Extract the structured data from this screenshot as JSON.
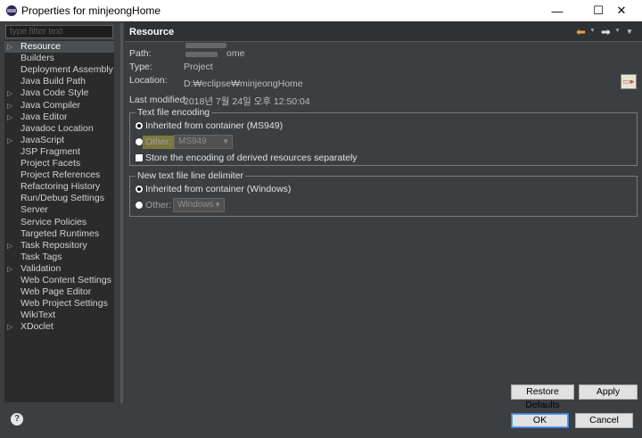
{
  "window": {
    "title": "Properties for minjeongHome",
    "minimize_glyph": "—",
    "maximize_glyph": "☐",
    "close_glyph": "✕"
  },
  "sidebar": {
    "filter_placeholder": "type filter text",
    "items": [
      {
        "label": "Resource",
        "has_arrow": true,
        "selected": true
      },
      {
        "label": "Builders",
        "has_arrow": false
      },
      {
        "label": "Deployment Assembly",
        "has_arrow": false
      },
      {
        "label": "Java Build Path",
        "has_arrow": false
      },
      {
        "label": "Java Code Style",
        "has_arrow": true
      },
      {
        "label": "Java Compiler",
        "has_arrow": true
      },
      {
        "label": "Java Editor",
        "has_arrow": true
      },
      {
        "label": "Javadoc Location",
        "has_arrow": false
      },
      {
        "label": "JavaScript",
        "has_arrow": true
      },
      {
        "label": "JSP Fragment",
        "has_arrow": false
      },
      {
        "label": "Project Facets",
        "has_arrow": false
      },
      {
        "label": "Project References",
        "has_arrow": false
      },
      {
        "label": "Refactoring History",
        "has_arrow": false
      },
      {
        "label": "Run/Debug Settings",
        "has_arrow": false
      },
      {
        "label": "Server",
        "has_arrow": false
      },
      {
        "label": "Service Policies",
        "has_arrow": false
      },
      {
        "label": "Targeted Runtimes",
        "has_arrow": false
      },
      {
        "label": "Task Repository",
        "has_arrow": true
      },
      {
        "label": "Task Tags",
        "has_arrow": false
      },
      {
        "label": "Validation",
        "has_arrow": true
      },
      {
        "label": "Web Content Settings",
        "has_arrow": false
      },
      {
        "label": "Web Page Editor",
        "has_arrow": false
      },
      {
        "label": "Web Project Settings",
        "has_arrow": false
      },
      {
        "label": "WikiText",
        "has_arrow": false
      },
      {
        "label": "XDoclet",
        "has_arrow": true
      }
    ]
  },
  "panel": {
    "title": "Resource",
    "path_label": "Path:",
    "path_value": "ome",
    "type_label": "Type:",
    "type_value": "Project",
    "location_label": "Location:",
    "location_value": "D:₩eclipse₩minjeongHome",
    "last_modified_label": "Last modified:",
    "last_modified_value": "2018년 7월 24일 오후 12:50:04"
  },
  "encoding": {
    "legend": "Text file encoding",
    "inherited_label": "Inherited from container (MS949)",
    "other_label": "Other:",
    "other_value": "MS949",
    "store_label": "Store the encoding of derived resources separately"
  },
  "delimiter": {
    "legend": "New text file line delimiter",
    "inherited_label": "Inherited from container (Windows)",
    "other_label": "Other:",
    "other_value": "Windows"
  },
  "buttons": {
    "restore_defaults": "Restore Defaults",
    "apply": "Apply",
    "ok": "OK",
    "cancel": "Cancel",
    "help": "?"
  },
  "colors": {
    "background": "#3c3f41",
    "sidebar": "#2b2b2b",
    "back_arrow": "#e7a33e"
  },
  "icons": {
    "app": "eclipse-icon",
    "back": "back-arrow-icon",
    "forward": "forward-arrow-icon",
    "view_menu": "view-menu-icon",
    "location_open": "open-folder-icon",
    "help": "help-icon"
  }
}
